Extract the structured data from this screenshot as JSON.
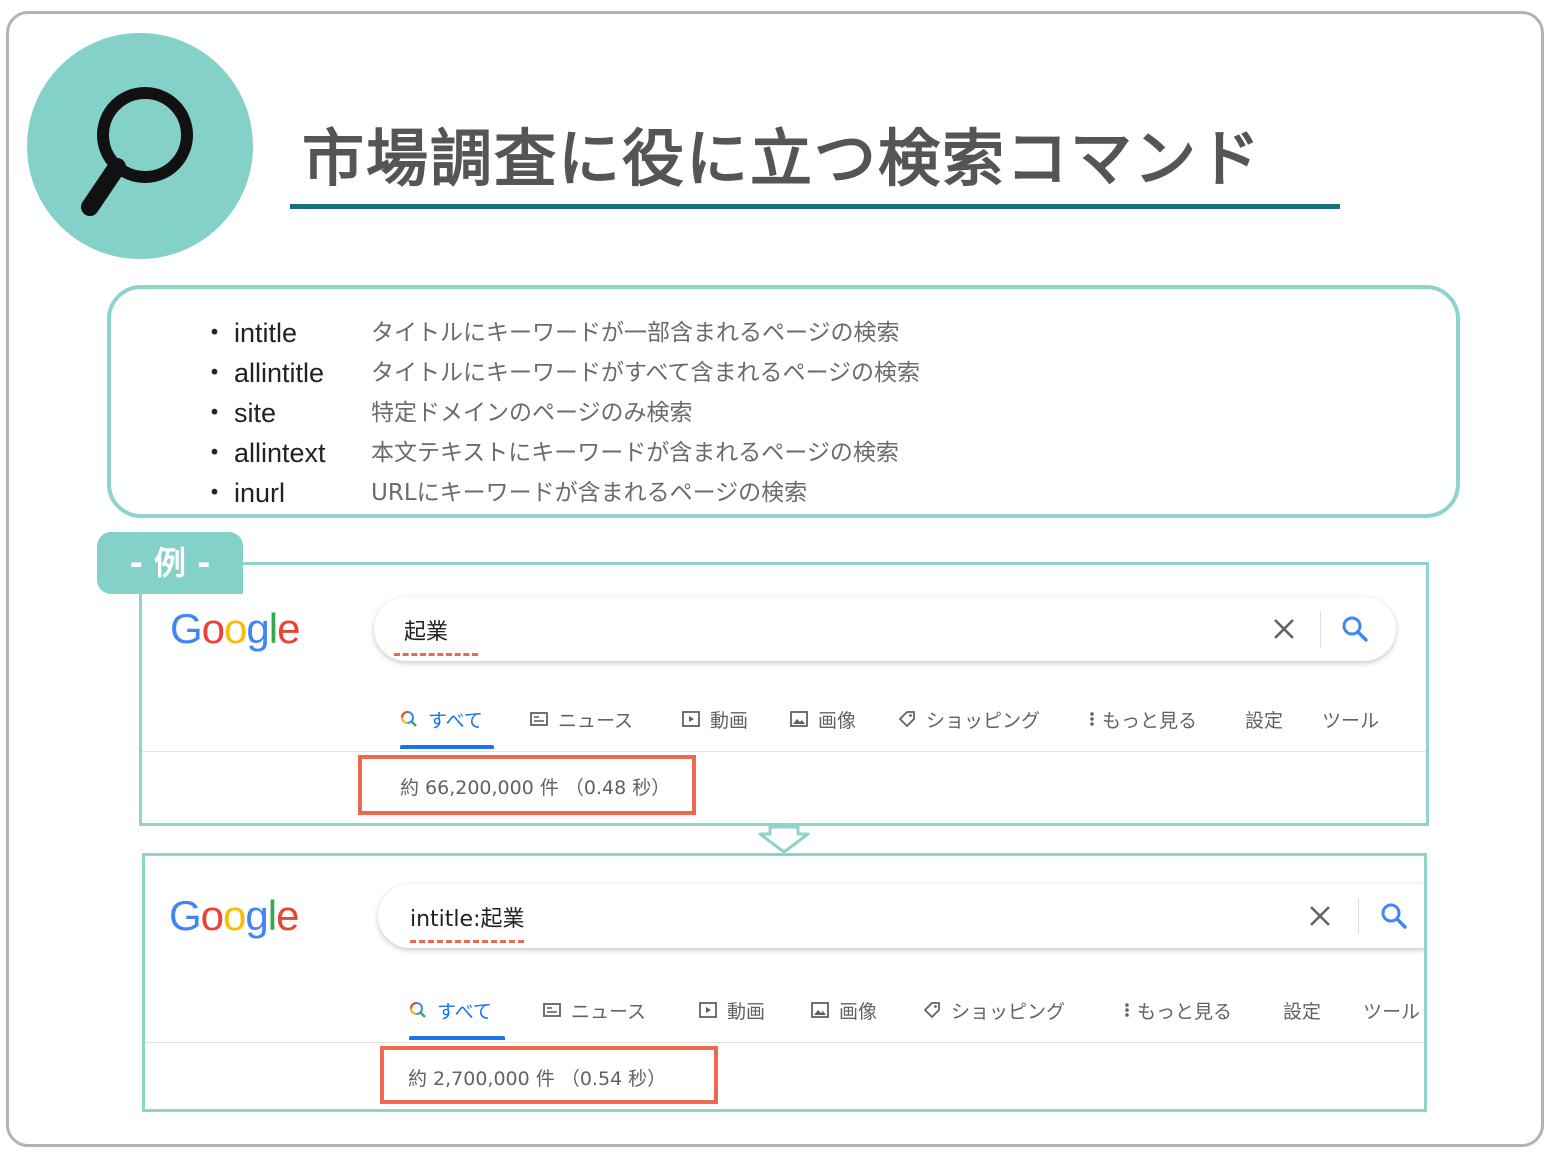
{
  "header": {
    "title": "市場調査に役に立つ検索コマンド",
    "logo_icon": "search-icon",
    "accent_color": "#84d1c9",
    "rule_color": "#16737a"
  },
  "commands": [
    {
      "bullet": "・",
      "name": "intitle",
      "description": "タイトルにキーワードが一部含まれるページの検索"
    },
    {
      "bullet": "・",
      "name": "allintitle",
      "description": "タイトルにキーワードがすべて含まれるページの検索"
    },
    {
      "bullet": "・",
      "name": "site",
      "description": "特定ドメインのページのみ検索"
    },
    {
      "bullet": "・",
      "name": "allintext",
      "description": "本文テキストにキーワードが含まれるページの検索"
    },
    {
      "bullet": "・",
      "name": "inurl",
      "description": "URLにキーワードが含まれるページの検索"
    }
  ],
  "example_label": "- 例 -",
  "google_logo": [
    "G",
    "o",
    "o",
    "g",
    "l",
    "e"
  ],
  "tabs": [
    "すべて",
    "ニュース",
    "動画",
    "画像",
    "ショッピング",
    "もっと見る",
    "設定",
    "ツール"
  ],
  "tab_icons": [
    "search-icon",
    "news-icon",
    "video-icon",
    "image-icon",
    "tag-icon",
    "more-icon",
    "",
    ""
  ],
  "example1": {
    "query": "起業",
    "result_stats": "約 66,200,000 件 （0.48 秒）"
  },
  "example2": {
    "query": "intitle:起業",
    "result_stats": "約 2,700,000 件 （0.54 秒）"
  },
  "colors": {
    "google_blue": "#4285f4",
    "google_red": "#ea4335",
    "google_yellow": "#fbbc05",
    "google_green": "#34a853",
    "highlight_box": "#ee6a4f",
    "squiggle": "#e66a54",
    "panel_border": "#8fd4cc"
  }
}
